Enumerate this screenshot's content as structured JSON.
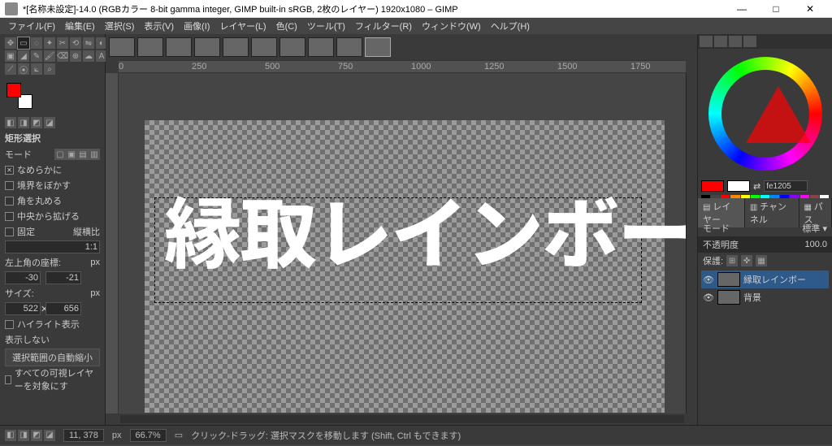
{
  "title": "*[名称未設定]-14.0 (RGBカラー 8-bit gamma integer, GIMP built-in sRGB, 2枚のレイヤー) 1920x1080 – GIMP",
  "menu": [
    "ファイル(F)",
    "編集(E)",
    "選択(S)",
    "表示(V)",
    "画像(I)",
    "レイヤー(L)",
    "色(C)",
    "ツール(T)",
    "フィルター(R)",
    "ウィンドウ(W)",
    "ヘルプ(H)"
  ],
  "ruler": {
    "marks": [
      "0",
      "250",
      "500",
      "750",
      "1000",
      "1250",
      "1500",
      "1750"
    ]
  },
  "canvas_text": "縁取レインボー",
  "tool_options": {
    "header": "矩形選択",
    "mode_label": "モード",
    "antialias": "なめらかに",
    "feather": "境界をぼかす",
    "round": "角を丸める",
    "expand": "中央から拡げる",
    "fixed": "固定",
    "fixed_mode": "縦横比",
    "ratio": "1:1",
    "pos_label": "左上角の座標:",
    "pos_x": "-30",
    "pos_y": "-21",
    "size_label": "サイズ:",
    "size_w": "522",
    "size_h": "656",
    "highlight": "ハイライト表示",
    "noshow": "表示しない",
    "autoshrink": "選択範囲の自動縮小",
    "alllayers": "すべての可視レイヤーを対象にす",
    "px": "px"
  },
  "hex": "fe1205",
  "dock_tabs": [
    "レイヤー",
    "チャンネル",
    "パス"
  ],
  "layer_mode_label": "モード",
  "layer_mode_value": "標準",
  "opacity_label": "不透明度",
  "opacity_value": "100.0",
  "protect_label": "保護:",
  "layers": [
    {
      "name": "縁取レインボー",
      "selected": true
    },
    {
      "name": "背景",
      "selected": false
    }
  ],
  "status": {
    "coords": "11, 378",
    "unit": "px",
    "zoom": "66.7%",
    "hint": "クリック-ドラッグ: 選択マスクを移動します (Shift, Ctrl もできます)"
  },
  "palette_colors": [
    "#000",
    "#444",
    "#f00",
    "#f80",
    "#ff0",
    "#0f0",
    "#0ff",
    "#08f",
    "#00f",
    "#80f",
    "#f0f",
    "#844",
    "#fff"
  ]
}
